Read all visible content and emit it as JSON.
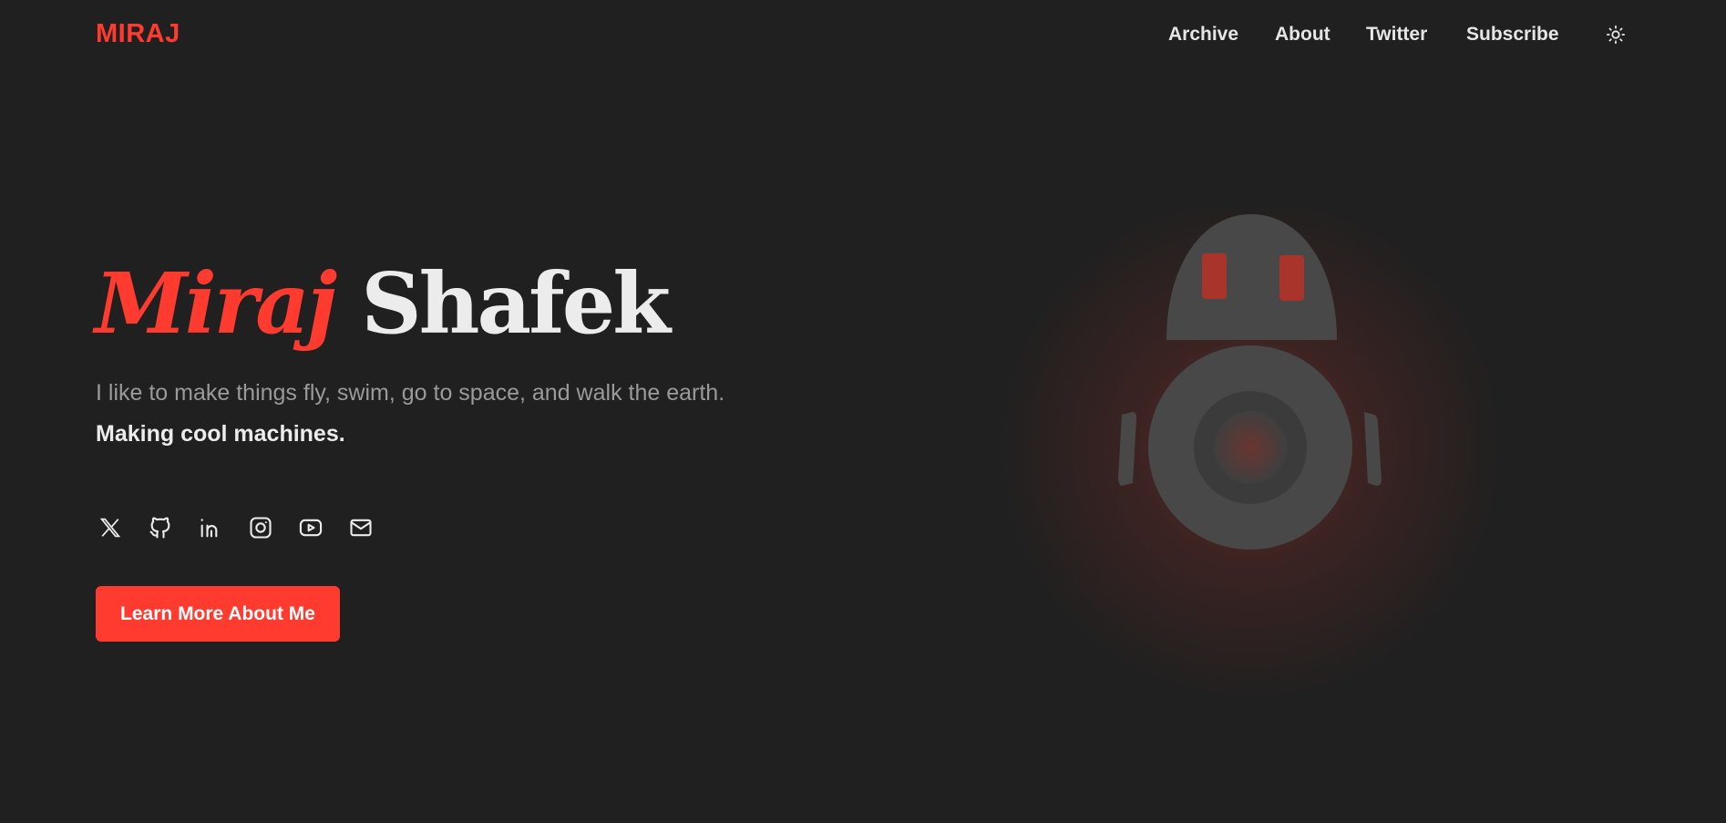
{
  "brand": {
    "logo_text": "MIRAJ",
    "accent_color": "#ff3b30"
  },
  "nav": {
    "items": [
      {
        "label": "Archive"
      },
      {
        "label": "About"
      },
      {
        "label": "Twitter"
      },
      {
        "label": "Subscribe"
      }
    ],
    "theme_toggle_icon": "sun-icon"
  },
  "hero": {
    "first_name": "Miraj",
    "last_name": "Shafek",
    "tagline": "I like to make things fly, swim, go to space, and walk the earth.",
    "subtagline": "Making cool machines.",
    "cta_label": "Learn More About Me"
  },
  "socials": [
    {
      "icon": "x-icon"
    },
    {
      "icon": "github-icon"
    },
    {
      "icon": "linkedin-icon"
    },
    {
      "icon": "instagram-icon"
    },
    {
      "icon": "youtube-icon"
    },
    {
      "icon": "mail-icon"
    }
  ],
  "illustration": {
    "icon": "robot-illustration",
    "body_color": "#484848",
    "eye_color": "#a8342b"
  },
  "colors": {
    "background": "#202020",
    "text": "#ececec",
    "muted": "#9a9a9a"
  }
}
